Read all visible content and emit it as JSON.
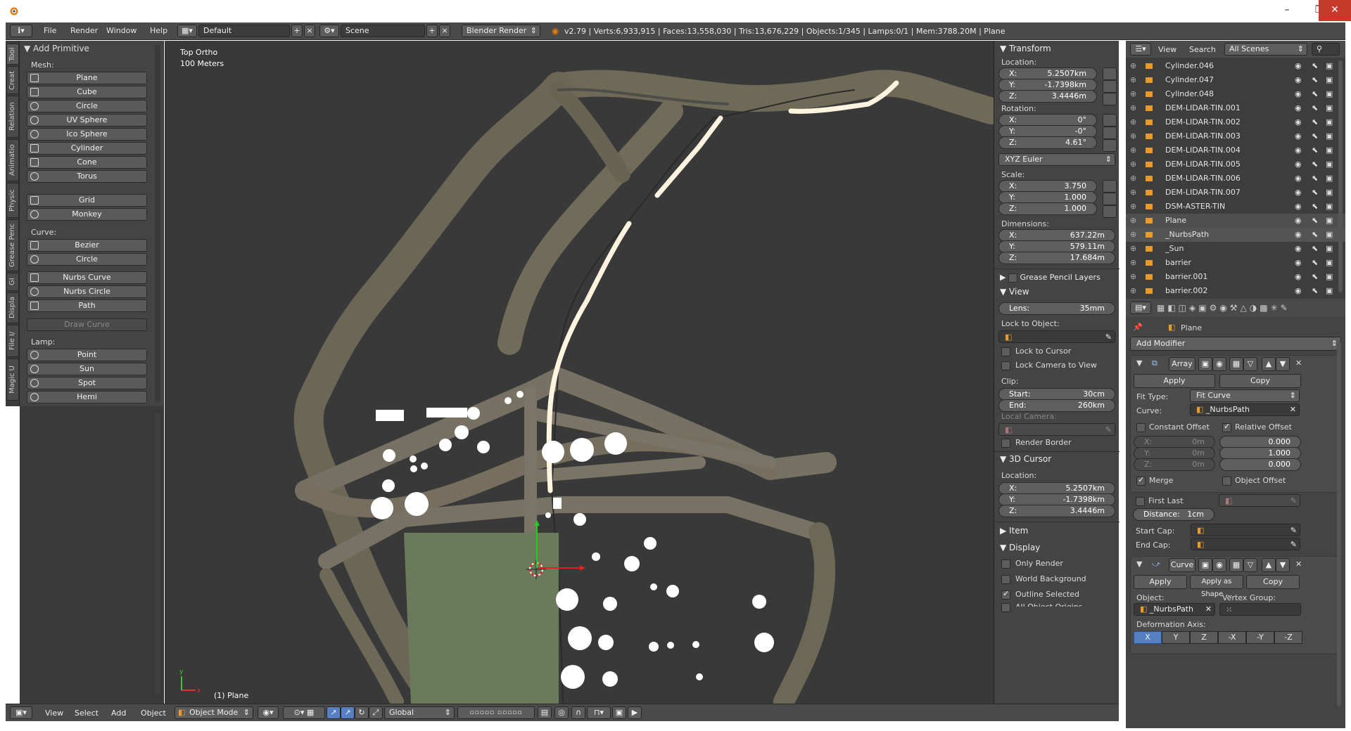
{
  "infobar": {
    "menus": [
      "File",
      "Render",
      "Window",
      "Help"
    ],
    "layout": "Default",
    "scene": "Scene",
    "engine": "Blender Render",
    "stats": "v2.79 | Verts:6,933,915 | Faces:13,558,030 | Tris:13,676,229 | Objects:1/345 | Lamps:0/1 | Mem:3788.20M | Plane"
  },
  "tooltabs": [
    "Tool",
    "Creat",
    "Relation",
    "Animatio",
    "Physic",
    "Grease Penc",
    "GI",
    "Displa",
    "File I/",
    "Magic U"
  ],
  "toolpanel": {
    "header": "Add Primitive",
    "mesh_label": "Mesh:",
    "mesh": [
      "Plane",
      "Cube",
      "Circle",
      "UV Sphere",
      "Ico Sphere",
      "Cylinder",
      "Cone",
      "Torus"
    ],
    "mesh2": [
      "Grid",
      "Monkey"
    ],
    "curve_label": "Curve:",
    "curve": [
      "Bezier",
      "Circle"
    ],
    "curve2": [
      "Nurbs Curve",
      "Nurbs Circle",
      "Path"
    ],
    "draw_curve": "Draw Curve",
    "lamp_label": "Lamp:",
    "lamp": [
      "Point",
      "Sun",
      "Spot",
      "Hemi"
    ]
  },
  "viewport": {
    "view_name": "Top Ortho",
    "scale": "100 Meters",
    "object_label": "(1) Plane"
  },
  "npanel": {
    "transform": "Transform",
    "location_label": "Location:",
    "location": [
      {
        "k": "X:",
        "v": "5.2507km"
      },
      {
        "k": "Y:",
        "v": "-1.7398km"
      },
      {
        "k": "Z:",
        "v": "3.4446m"
      }
    ],
    "rotation_label": "Rotation:",
    "rotation": [
      {
        "k": "X:",
        "v": "0°"
      },
      {
        "k": "Y:",
        "v": "-0°"
      },
      {
        "k": "Z:",
        "v": "4.61°"
      }
    ],
    "rotation_mode": "XYZ Euler",
    "scale_label": "Scale:",
    "scale": [
      {
        "k": "X:",
        "v": "3.750"
      },
      {
        "k": "Y:",
        "v": "1.000"
      },
      {
        "k": "Z:",
        "v": "1.000"
      }
    ],
    "dimensions_label": "Dimensions:",
    "dimensions": [
      {
        "k": "X:",
        "v": "637.22m"
      },
      {
        "k": "Y:",
        "v": "579.11m"
      },
      {
        "k": "Z:",
        "v": "17.684m"
      }
    ],
    "grease_pencil": "Grease Pencil Layers",
    "view": "View",
    "lens_k": "Lens:",
    "lens_v": "35mm",
    "lock_to_object": "Lock to Object:",
    "lock_to_cursor": "Lock to Cursor",
    "lock_camera": "Lock Camera to View",
    "clip": "Clip:",
    "clip_start_k": "Start:",
    "clip_start_v": "30cm",
    "clip_end_k": "End:",
    "clip_end_v": "260km",
    "local_camera": "Local Camera:",
    "render_border": "Render Border",
    "cursor": "3D Cursor",
    "cursor_location_label": "Location:",
    "cursor_location": [
      {
        "k": "X:",
        "v": "5.2507km"
      },
      {
        "k": "Y:",
        "v": "-1.7398km"
      },
      {
        "k": "Z:",
        "v": "3.4446m"
      }
    ],
    "item": "Item",
    "display": "Display",
    "only_render": "Only Render",
    "world_background": "World Background",
    "outline_selected": "Outline Selected",
    "all_object_origins": "All Object Origins"
  },
  "outliner": {
    "view": "View",
    "search": "Search",
    "filter": "All Scenes",
    "rows": [
      "Cylinder.046",
      "Cylinder.047",
      "Cylinder.048",
      "DEM-LIDAR-TIN.001",
      "DEM-LIDAR-TIN.002",
      "DEM-LIDAR-TIN.003",
      "DEM-LIDAR-TIN.004",
      "DEM-LIDAR-TIN.005",
      "DEM-LIDAR-TIN.006",
      "DEM-LIDAR-TIN.007",
      "DSM-ASTER-TIN",
      "Plane",
      "_NurbsPath",
      "_Sun",
      "barrier",
      "barrier.001",
      "barrier.002"
    ]
  },
  "props": {
    "object_name": "Plane",
    "add_modifier": "Add Modifier",
    "array": {
      "name": "Array",
      "apply": "Apply",
      "copy": "Copy",
      "fit_type_label": "Fit Type:",
      "fit_type": "Fit Curve",
      "curve_label": "Curve:",
      "curve": "_NurbsPath",
      "constant_offset": "Constant Offset",
      "relative_offset": "Relative Offset",
      "const": [
        {
          "k": "X:",
          "v": "0m"
        },
        {
          "k": "Y:",
          "v": "0m"
        },
        {
          "k": "Z:",
          "v": "0m"
        }
      ],
      "rel": [
        "0.000",
        "1.000",
        "0.000"
      ],
      "merge": "Merge",
      "object_offset": "Object Offset",
      "first_last": "First Last",
      "distance_k": "Distance:",
      "distance_v": "1cm",
      "start_cap": "Start Cap:",
      "end_cap": "End Cap:"
    },
    "curve_mod": {
      "name": "Curve",
      "apply": "Apply",
      "apply_shape": "Apply as Shape ...",
      "copy": "Copy",
      "object_label": "Object:",
      "object": "_NurbsPath",
      "vgroup_label": "Vertex Group:",
      "deform_label": "Deformation Axis:",
      "axes": [
        "X",
        "Y",
        "Z",
        "-X",
        "-Y",
        "-Z"
      ]
    }
  },
  "footer": {
    "menus": [
      "View",
      "Select",
      "Add",
      "Object"
    ],
    "mode": "Object Mode",
    "orientation": "Global"
  }
}
